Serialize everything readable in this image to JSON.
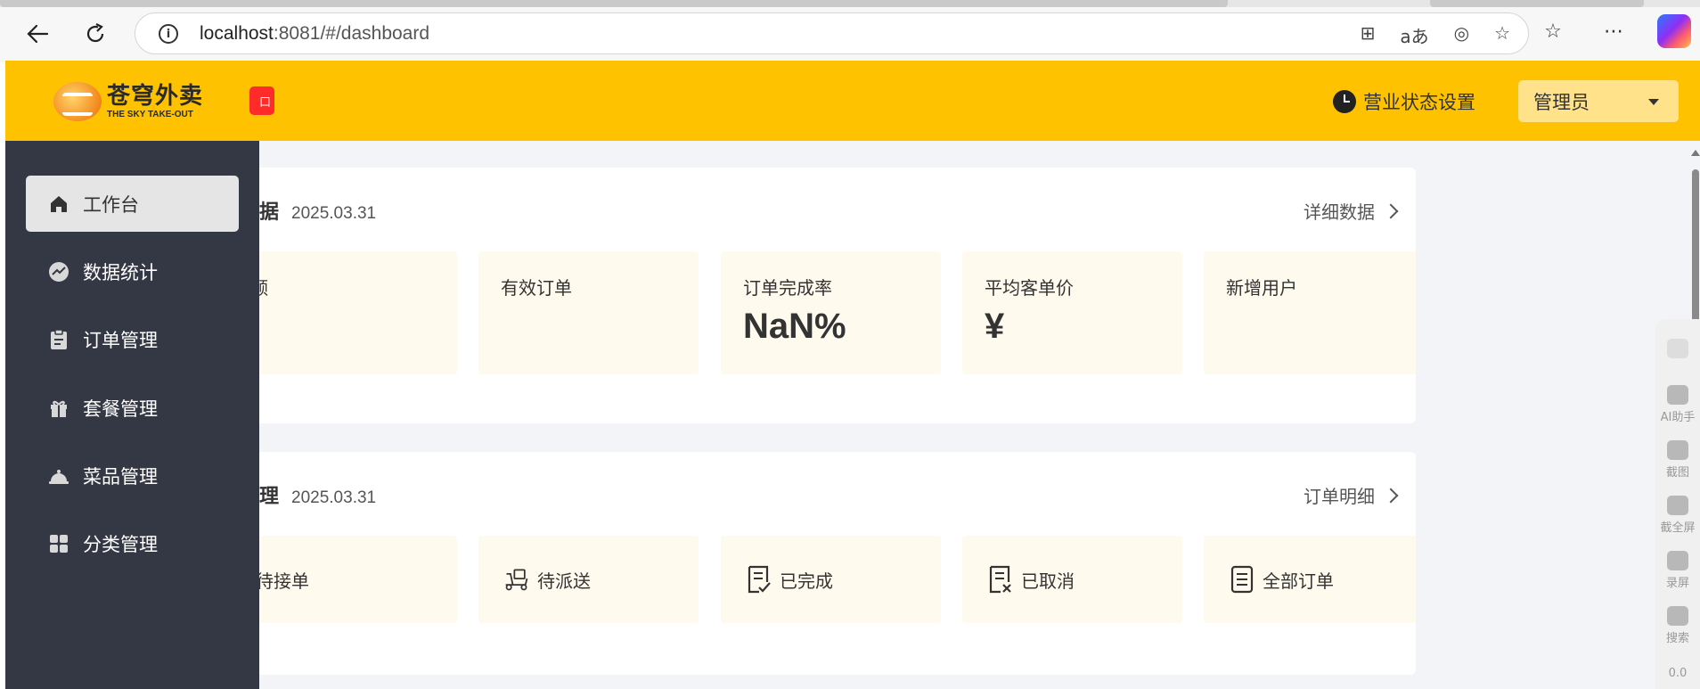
{
  "browser": {
    "url_host": "localhost",
    "url_path": ":8081/#/dashboard",
    "info_glyph": "i",
    "translate_label": "aあ"
  },
  "header": {
    "logo_cn": "苍穹外卖",
    "logo_en": "THE SKY TAKE-OUT",
    "badge_text": "口",
    "business_status": "营业状态设置",
    "admin_label": "管理员"
  },
  "sidebar": {
    "items": [
      {
        "label": "工作台",
        "icon": "home-icon",
        "active": true
      },
      {
        "label": "数据统计",
        "icon": "chart-icon",
        "active": false
      },
      {
        "label": "订单管理",
        "icon": "clipboard-icon",
        "active": false
      },
      {
        "label": "套餐管理",
        "icon": "gift-icon",
        "active": false
      },
      {
        "label": "菜品管理",
        "icon": "dish-icon",
        "active": false
      },
      {
        "label": "分类管理",
        "icon": "grid-icon",
        "active": false
      }
    ]
  },
  "business": {
    "title_visible": "据",
    "date": "2025.03.31",
    "link": "详细数据",
    "tiles": [
      {
        "label": "额",
        "value": ""
      },
      {
        "label": "有效订单",
        "value": ""
      },
      {
        "label": "订单完成率",
        "value": "NaN%"
      },
      {
        "label": "平均客单价",
        "value": "¥"
      },
      {
        "label": "新增用户",
        "value": ""
      }
    ]
  },
  "orders": {
    "title_visible": "理",
    "date": "2025.03.31",
    "link": "订单明细",
    "tiles": [
      {
        "label": "待接单",
        "icon": "pending-icon"
      },
      {
        "label": "待派送",
        "icon": "delivery-scooter-icon"
      },
      {
        "label": "已完成",
        "icon": "completed-doc-icon"
      },
      {
        "label": "已取消",
        "icon": "cancelled-doc-icon"
      },
      {
        "label": "全部订单",
        "icon": "all-orders-doc-icon"
      }
    ]
  },
  "rightbar": {
    "items": [
      "AI助手",
      "截图",
      "截全屏",
      "录屏",
      "搜索"
    ],
    "footer": "0.0"
  }
}
